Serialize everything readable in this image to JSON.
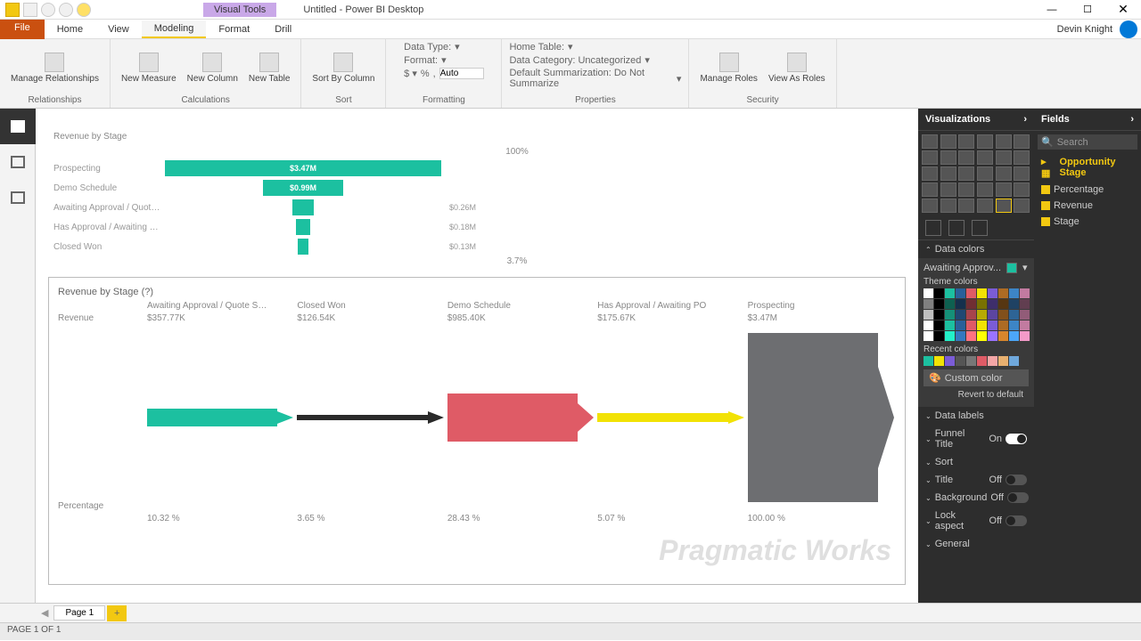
{
  "title": {
    "visual_tools": "Visual Tools",
    "doc": "Untitled - Power BI Desktop"
  },
  "menu": {
    "file": "File",
    "home": "Home",
    "view": "View",
    "modeling": "Modeling",
    "format": "Format",
    "drill": "Drill",
    "user": "Devin Knight"
  },
  "ribbon": {
    "relationships": {
      "manage": "Manage\nRelationships",
      "group": "Relationships"
    },
    "calc": {
      "measure": "New\nMeasure",
      "column": "New\nColumn",
      "table": "New\nTable",
      "group": "Calculations"
    },
    "sort": {
      "btn": "Sort By\nColumn",
      "group": "Sort"
    },
    "fmt": {
      "datatype": "Data Type:",
      "format": "Format:",
      "auto": "Auto",
      "group": "Formatting"
    },
    "props": {
      "hometable": "Home Table:",
      "datacat": "Data Category: Uncategorized",
      "defsum": "Default Summarization: Do Not Summarize",
      "group": "Properties"
    },
    "sec": {
      "manage": "Manage\nRoles",
      "viewas": "View As\nRoles",
      "group": "Security"
    }
  },
  "chart_data": [
    {
      "type": "bar",
      "title": "Revenue by Stage",
      "orientation": "funnel",
      "top_label": "100%",
      "bottom_label": "3.7%",
      "categories": [
        "Prospecting",
        "Demo Schedule",
        "Awaiting Approval / Quote S…",
        "Has Approval / Awaiting PO",
        "Closed Won"
      ],
      "values": [
        3470000,
        999000,
        260000,
        180000,
        130000
      ],
      "value_labels": [
        "$3.47M",
        "$0.99M",
        "$0.26M",
        "$0.18M",
        "$0.13M"
      ]
    },
    {
      "type": "bar",
      "title": "Revenue by Stage (?)",
      "orientation": "horizontal-funnel",
      "row_labels": [
        "Revenue",
        "Percentage"
      ],
      "series": [
        {
          "name": "Awaiting Approval / Quote S…",
          "revenue": "$357.77K",
          "percentage": "10.32 %",
          "color": "#1cc0a0"
        },
        {
          "name": "Closed Won",
          "revenue": "$126.54K",
          "percentage": "3.65 %",
          "color": "#2a2a2a"
        },
        {
          "name": "Demo Schedule",
          "revenue": "$985.40K",
          "percentage": "28.43 %",
          "color": "#df5b66"
        },
        {
          "name": "Has Approval / Awaiting PO",
          "revenue": "$175.67K",
          "percentage": "5.07 %",
          "color": "#f2e205"
        },
        {
          "name": "Prospecting",
          "revenue": "$3.47M",
          "percentage": "100.00 %",
          "color": "#6d6e71"
        }
      ]
    }
  ],
  "vis_panel": {
    "header": "Visualizations",
    "data_colors": "Data colors",
    "awaiting": "Awaiting Approv...",
    "theme": "Theme colors",
    "recent": "Recent colors",
    "custom": "Custom color",
    "revert": "Revert to default",
    "data_labels": "Data labels",
    "funnel_title": "Funnel Title",
    "on": "On",
    "off": "Off",
    "sort": "Sort",
    "title": "Title",
    "background": "Background",
    "lock": "Lock aspect",
    "general": "General"
  },
  "fields_panel": {
    "header": "Fields",
    "search": "Search",
    "table": "Opportunity Stage",
    "fields": [
      "Percentage",
      "Revenue",
      "Stage"
    ]
  },
  "tabs": {
    "page1": "Page 1"
  },
  "status": "PAGE 1 OF 1",
  "theme_colors": [
    "#ffffff",
    "#000000",
    "#1cc0a0",
    "#2a6099",
    "#df5b66",
    "#f2e205",
    "#7b5cd6",
    "#ad6b24",
    "#3d85c6",
    "#c27ba0"
  ],
  "recent_colors": [
    "#1cc0a0",
    "#f2e205",
    "#7b5cd6",
    "#555555",
    "#777777",
    "#df5b66",
    "#f4a6a6",
    "#e8b070",
    "#6fa8dc"
  ],
  "watermark": "Pragmatic Works"
}
